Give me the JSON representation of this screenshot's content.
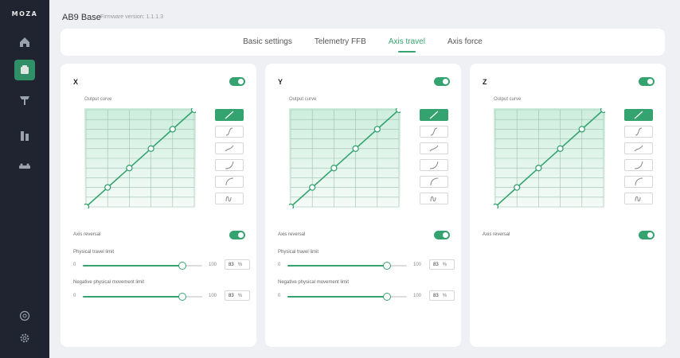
{
  "sidebar": {
    "logo": "MOZA",
    "items": [
      {
        "name": "home-icon",
        "active": false
      },
      {
        "name": "base-icon",
        "active": true
      },
      {
        "name": "wheel-icon",
        "active": false
      },
      {
        "name": "pedal-icon",
        "active": false
      },
      {
        "name": "handbrake-icon",
        "active": false
      }
    ],
    "bottom": [
      "support-icon",
      "settings-icon"
    ]
  },
  "header": {
    "title": "AB9 Base",
    "firmware": "Firmware version: 1.1.1.3"
  },
  "tabs": [
    {
      "label": "Basic settings",
      "active": false
    },
    {
      "label": "Telemetry FFB",
      "active": false
    },
    {
      "label": "Axis travel",
      "active": true
    },
    {
      "label": "Axis force",
      "active": false
    }
  ],
  "accent_color": "#35a36f",
  "panels": [
    {
      "axis": "X",
      "enabled": true,
      "curve_label": "Output curve",
      "curve_points": [
        [
          0,
          0
        ],
        [
          20,
          20
        ],
        [
          40,
          40
        ],
        [
          60,
          60
        ],
        [
          80,
          80
        ],
        [
          100,
          100
        ]
      ],
      "presets": [
        "linear",
        "s-curve",
        "soft",
        "exponential",
        "logarithmic",
        "custom"
      ],
      "active_preset": "linear",
      "axis_reversal_label": "Axis reversal",
      "axis_reversal": true,
      "physical_travel": {
        "label": "Physical travel limit",
        "min": "0",
        "max": "100",
        "value": "83",
        "unit": "%"
      },
      "negative_travel": {
        "label": "Negative physical movement limit",
        "min": "0",
        "max": "100",
        "value": "83",
        "unit": "%"
      }
    },
    {
      "axis": "Y",
      "enabled": true,
      "curve_label": "Output curve",
      "curve_points": [
        [
          0,
          0
        ],
        [
          20,
          20
        ],
        [
          40,
          40
        ],
        [
          60,
          60
        ],
        [
          80,
          80
        ],
        [
          100,
          100
        ]
      ],
      "presets": [
        "linear",
        "s-curve",
        "soft",
        "exponential",
        "logarithmic",
        "custom"
      ],
      "active_preset": "linear",
      "axis_reversal_label": "Axis reversal",
      "axis_reversal": true,
      "physical_travel": {
        "label": "Physical travel limit",
        "min": "0",
        "max": "100",
        "value": "83",
        "unit": "%"
      },
      "negative_travel": {
        "label": "Negative physical movement limit",
        "min": "0",
        "max": "100",
        "value": "83",
        "unit": "%"
      }
    },
    {
      "axis": "Z",
      "enabled": true,
      "curve_label": "Output curve",
      "curve_points": [
        [
          0,
          0
        ],
        [
          20,
          20
        ],
        [
          40,
          40
        ],
        [
          60,
          60
        ],
        [
          80,
          80
        ],
        [
          100,
          100
        ]
      ],
      "presets": [
        "linear",
        "s-curve",
        "soft",
        "exponential",
        "logarithmic",
        "custom"
      ],
      "active_preset": "linear",
      "axis_reversal_label": "Axis reversal",
      "axis_reversal": true
    }
  ]
}
